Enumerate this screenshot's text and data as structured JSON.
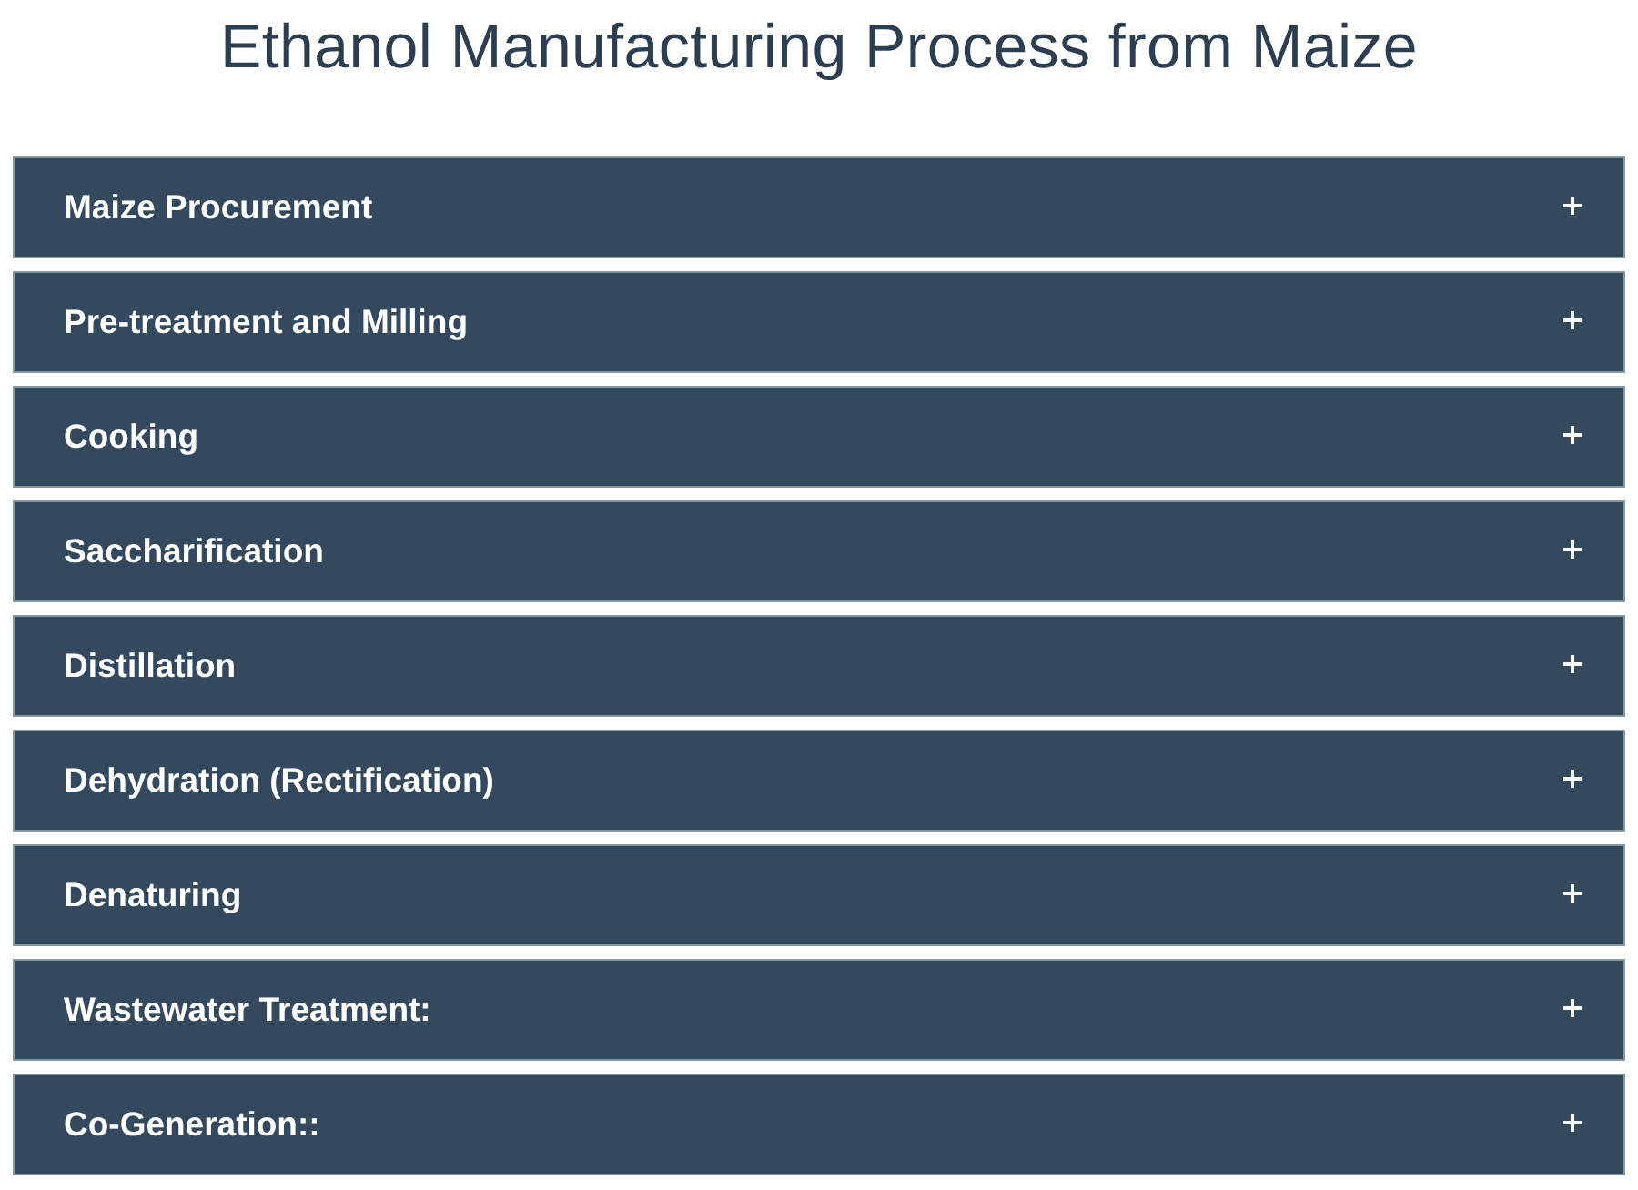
{
  "title": "Ethanol Manufacturing Process from Maize",
  "sections": [
    {
      "label": "Maize Procurement",
      "expanded": false
    },
    {
      "label": "Pre-treatment and Milling",
      "expanded": false
    },
    {
      "label": "Cooking",
      "expanded": false
    },
    {
      "label": "Saccharification",
      "expanded": false
    },
    {
      "label": "Distillation",
      "expanded": false
    },
    {
      "label": "Dehydration (Rectification)",
      "expanded": false
    },
    {
      "label": "Denaturing",
      "expanded": false
    },
    {
      "label": "Wastewater Treatment:",
      "expanded": false
    },
    {
      "label": "Co-Generation::",
      "expanded": false
    }
  ]
}
